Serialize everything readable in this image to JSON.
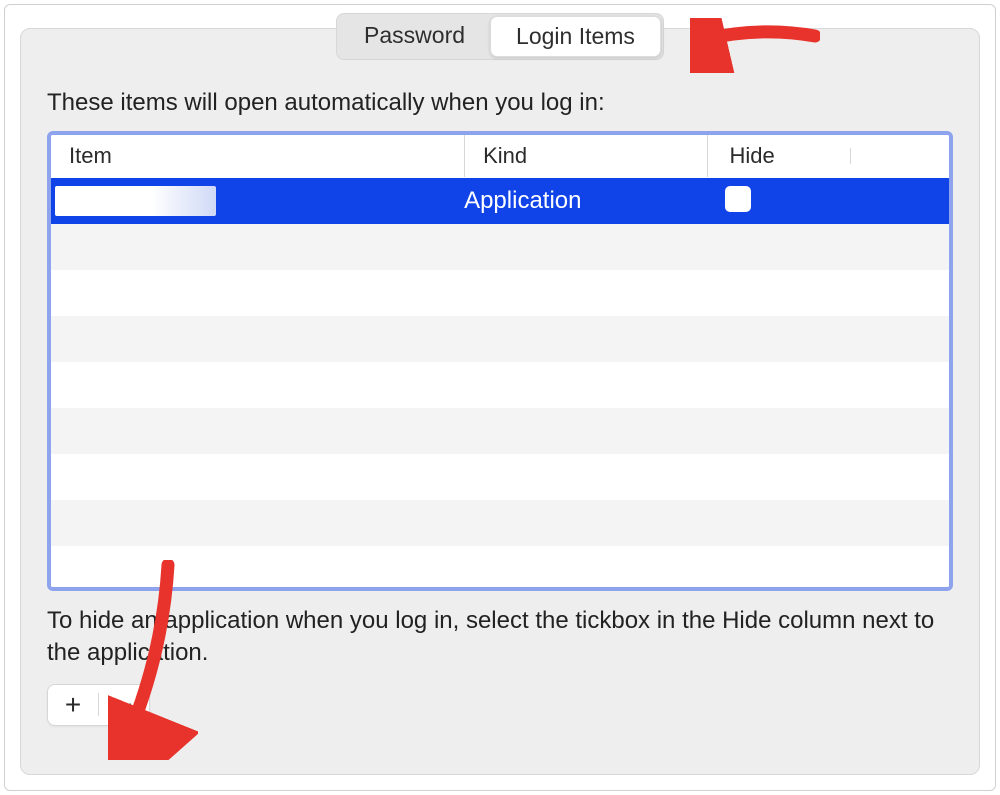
{
  "tabs": {
    "password": "Password",
    "login_items": "Login Items",
    "active": "login_items"
  },
  "heading": "These items will open automatically when you log in:",
  "columns": {
    "item": "Item",
    "kind": "Kind",
    "hide": "Hide"
  },
  "rows": [
    {
      "item": "",
      "kind": "Application",
      "hide": false,
      "selected": true
    }
  ],
  "footer_text": "To hide an application when you log in, select the tickbox in the Hide column next to the application.",
  "buttons": {
    "add": "+",
    "remove": "−"
  },
  "colors": {
    "selection": "#1044e9",
    "focus_ring": "#8ea3ee",
    "panel_bg": "#eeeeee",
    "annotation": "#e8332c"
  }
}
